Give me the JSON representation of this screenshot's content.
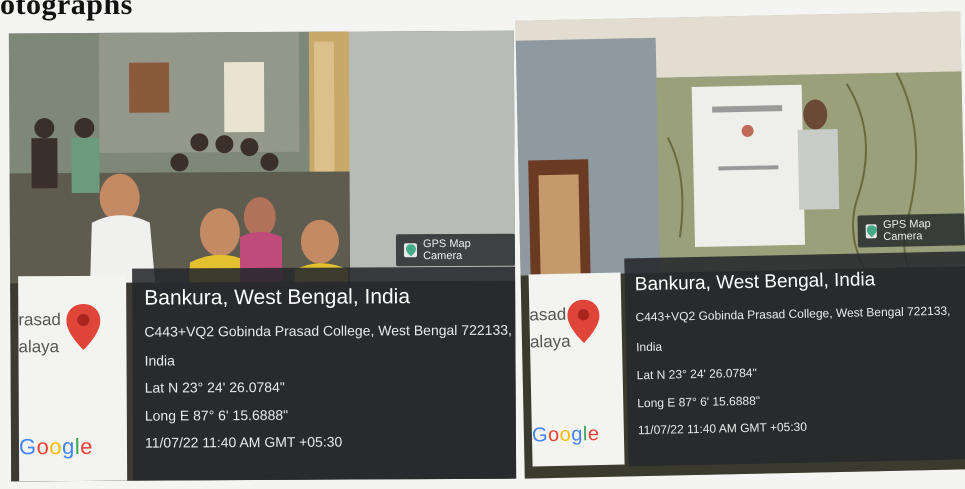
{
  "heading": "otographs",
  "photos": [
    {
      "gps_label": "GPS Map Camera",
      "thumb_text": [
        "rasad",
        "alaya"
      ],
      "google": "Google",
      "location": "Bankura, West Bengal, India",
      "address_line1": "C443+VQ2 Gobinda Prasad College, West Bengal 722133,",
      "address_line2": "India",
      "lat": "Lat N 23° 24' 26.0784\"",
      "long": "Long E 87° 6' 15.6888\"",
      "datetime": "11/07/22 11:40 AM GMT +05:30"
    },
    {
      "gps_label": "GPS Map Camera",
      "thumb_text": [
        "asad",
        "alaya"
      ],
      "google": "Google",
      "location": "Bankura, West Bengal, India",
      "address_line1": "C443+VQ2 Gobinda Prasad College, West Bengal 722133,",
      "address_line2": "India",
      "lat": "Lat N 23° 24' 26.0784\"",
      "long": "Long E 87° 6' 15.6888\"",
      "datetime": "11/07/22 11:40 AM GMT +05:30"
    }
  ],
  "colors": {
    "overlay": "#26282c",
    "marker": "#e0453a"
  }
}
